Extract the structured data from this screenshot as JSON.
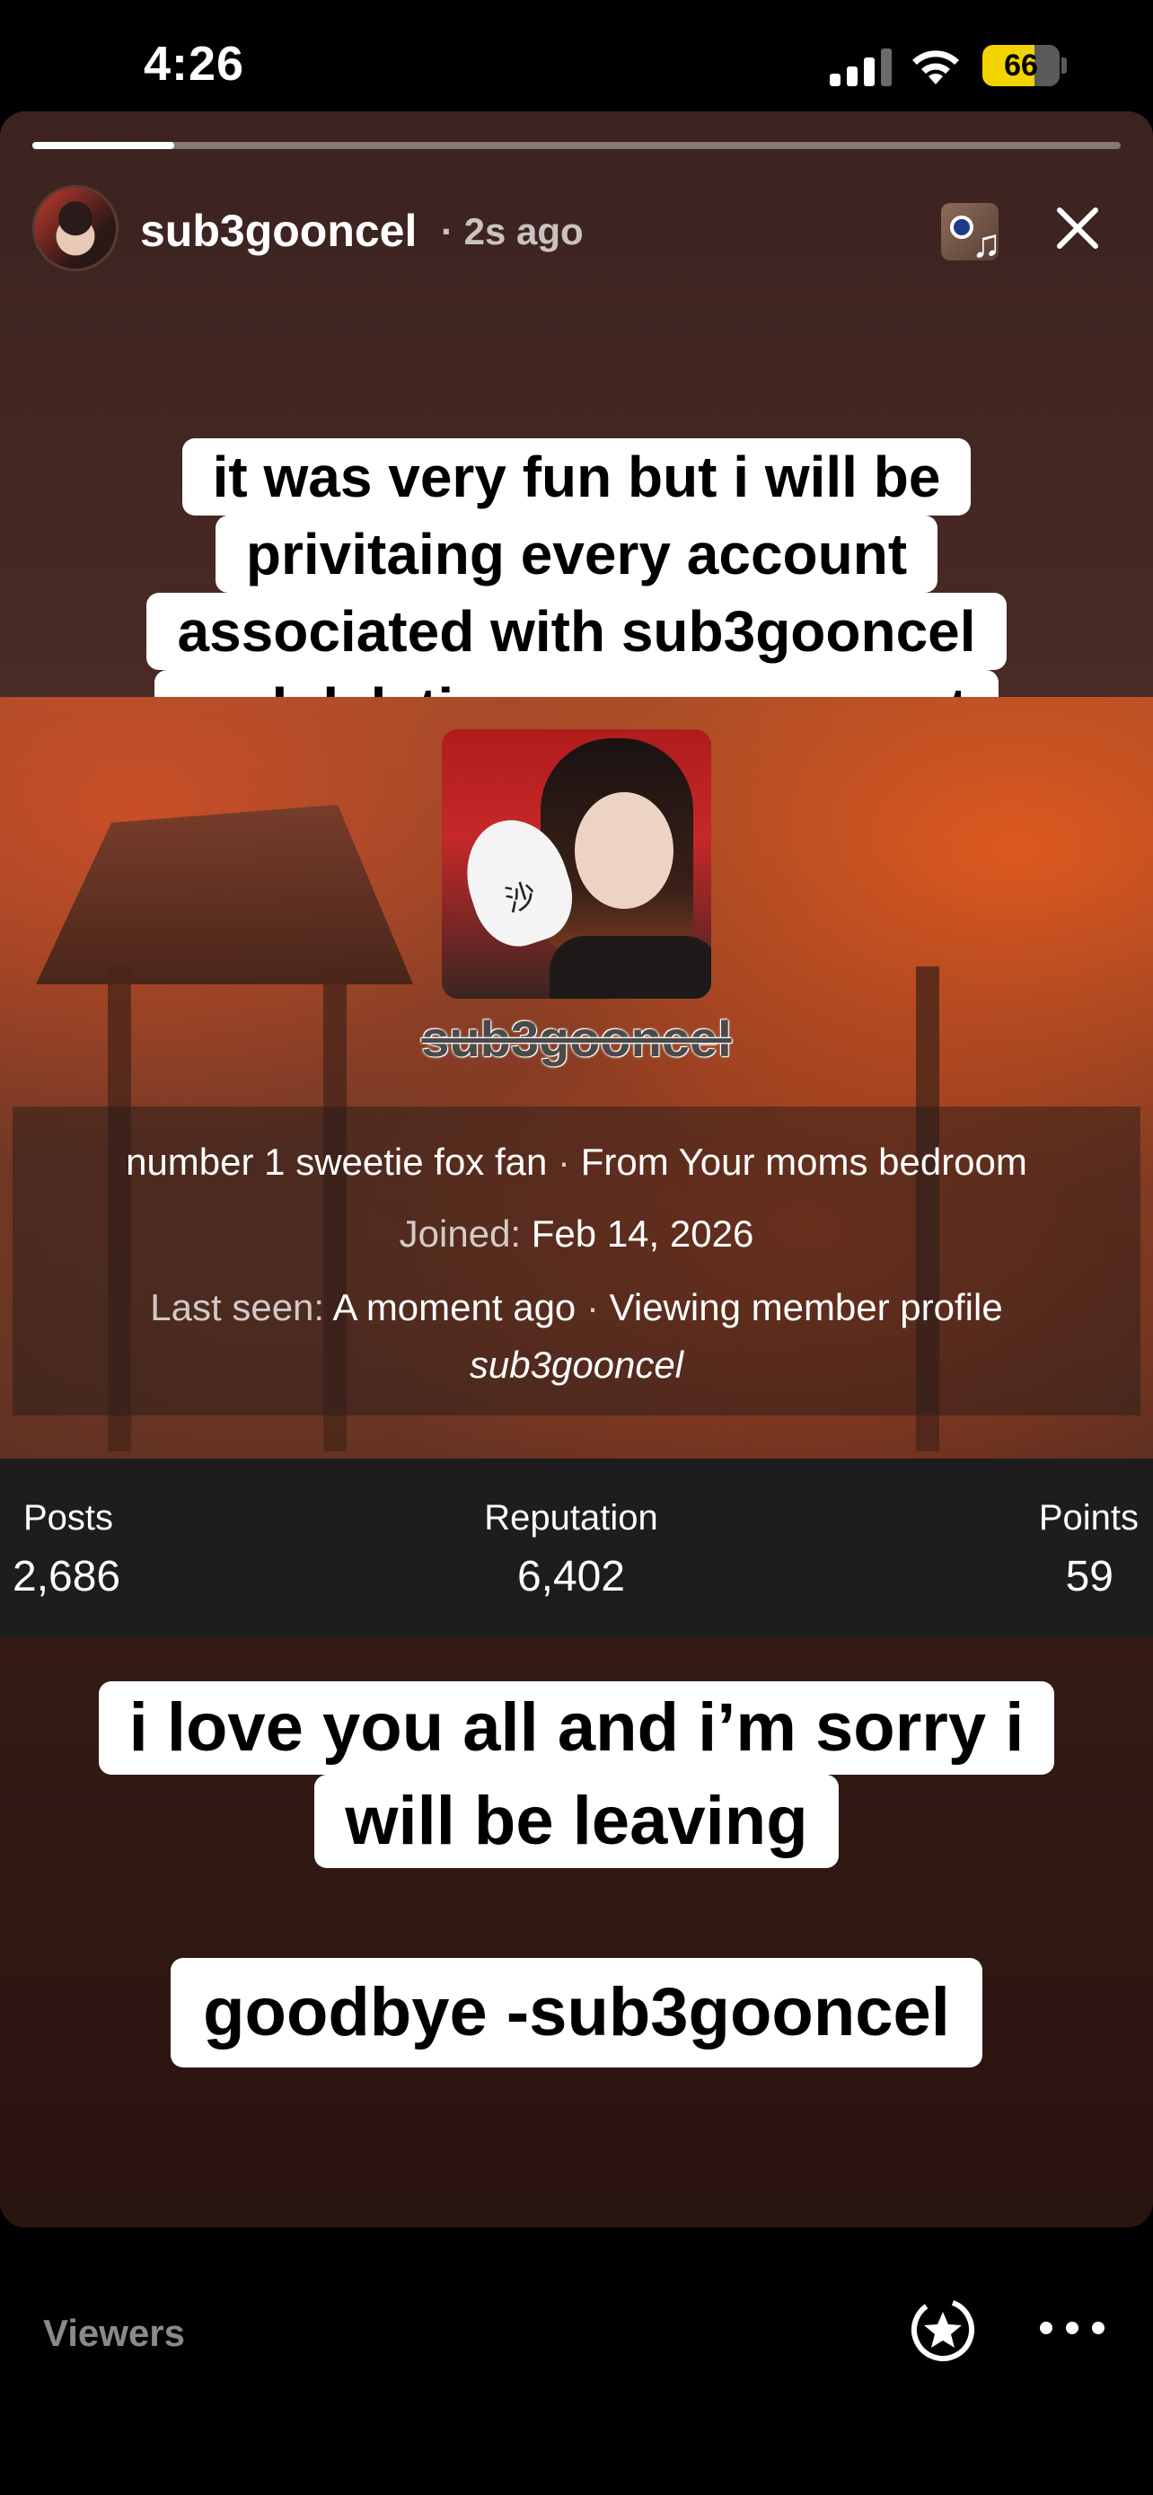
{
  "status_bar": {
    "time": "4:26",
    "battery_percent": "66",
    "battery_color": "#f2d300"
  },
  "story": {
    "progress": 0.13,
    "username": "sub3gooncel",
    "time_ago": "· 2s ago",
    "icons": {
      "music": "music-note-icon",
      "close": "close-icon"
    },
    "caption_top": [
      "it was very fun but i will be",
      "privitaing every account",
      "associated with sub3gooncel",
      "and deleting my org account"
    ],
    "caption_middle": [
      "i love you all and i’m sorry i",
      "will be leaving"
    ],
    "caption_bottom": "goodbye -sub3gooncel"
  },
  "profile_screenshot": {
    "name": "sub3gooncel",
    "bio": "number 1 sweetie fox fan",
    "from": "From Your moms bedroom",
    "joined_label": "Joined:",
    "joined_value": "Feb 14, 2026",
    "last_seen_label": "Last seen:",
    "last_seen_value": "A moment ago",
    "activity": "Viewing member profile",
    "activity_target": "sub3gooncel",
    "stats": [
      {
        "label": "Posts",
        "value": "2,686"
      },
      {
        "label": "Reputation",
        "value": "6,402"
      },
      {
        "label": "Points",
        "value": "59"
      }
    ]
  },
  "bottom_bar": {
    "viewers_label": "Viewers",
    "icons": {
      "favorite": "star-circle-icon",
      "more": "more-options-icon"
    }
  }
}
